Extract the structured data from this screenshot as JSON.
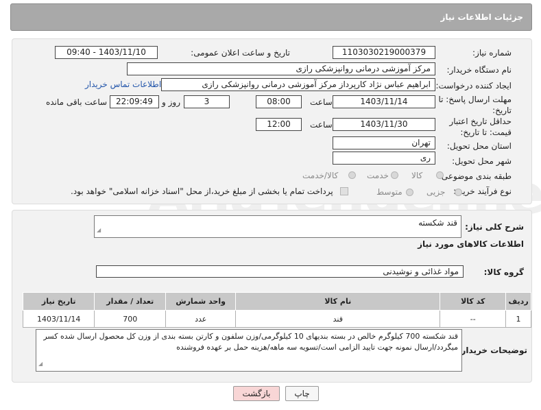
{
  "header": {
    "title": "جزئیات اطلاعات نیاز"
  },
  "form": {
    "need_number_label": "شماره نیاز:",
    "need_number": "1103030219000379",
    "announce_label": "تاریخ و ساعت اعلان عمومی:",
    "announce_value": "1403/11/10 - 09:40",
    "buyer_label": "نام دستگاه خریدار:",
    "buyer_value": "مرکز آموزشی درمانی روانپزشکی رازی",
    "creator_label": "ایجاد کننده درخواست:",
    "creator_value": "ابراهیم عباس نژاد کارپرداز مرکز آموزشی درمانی روانپزشکی رازی",
    "contact_link": "اطلاعات تماس خریدار",
    "deadline_label": "مهلت ارسال پاسخ: تا تاریخ:",
    "deadline_date": "1403/11/14",
    "time_label": "ساعت",
    "deadline_time": "08:00",
    "days_value": "3",
    "days_label": "روز و",
    "remaining_value": "22:09:49",
    "remaining_label": "ساعت باقی مانده",
    "validity_label": "حداقل تاریخ اعتبار قیمت: تا تاریخ:",
    "validity_date": "1403/11/30",
    "validity_time_label": "ساعت",
    "validity_time": "12:00",
    "province_label": "استان محل تحویل:",
    "province_value": "تهران",
    "city_label": "شهر محل تحویل:",
    "city_value": "ری",
    "category_label": "طبقه بندی موضوعی:",
    "category_options": [
      "کالا",
      "خدمت",
      "کالا/خدمت"
    ],
    "process_label": "نوع فرآیند خرید :",
    "process_options": [
      "جزیی",
      "متوسط"
    ],
    "payment_note": "پرداخت تمام یا بخشی از مبلغ خرید،از محل \"اسناد خزانه اسلامی\" خواهد بود."
  },
  "details": {
    "description_label": "شرح کلی نیاز:",
    "description_value": "قند شکسته",
    "goods_info_title": "اطلاعات کالاهای مورد نیاز",
    "group_label": "گروه کالا:",
    "group_value": "مواد غذائی و نوشیدنی",
    "table": {
      "headers": [
        "ردیف",
        "کد کالا",
        "نام کالا",
        "واحد شمارش",
        "تعداد / مقدار",
        "تاریخ نیاز"
      ],
      "rows": [
        [
          "1",
          "--",
          "قند",
          "عدد",
          "700",
          "1403/11/14"
        ]
      ]
    },
    "buyer_notes_label": "توضیحات خریدار:",
    "buyer_notes": "قند شکسته 700 کیلوگرم خالص در بسته بندیهای 10 کیلوگرمی/وزن سلفون و کارتن بسته بندی از وزن کل محصول ارسال شده کسر میگردد/ارسال نمونه جهت تایید الزامی است/تسویه سه ماهه/هزینه حمل بر عهده فروشنده"
  },
  "buttons": {
    "print": "چاپ",
    "back": "بازگشت"
  },
  "watermark": "AriaTender.neT",
  "colors": {
    "header_bg": "#a9a9a9",
    "link": "#2255aa",
    "back_btn": "#f8d6d6"
  }
}
